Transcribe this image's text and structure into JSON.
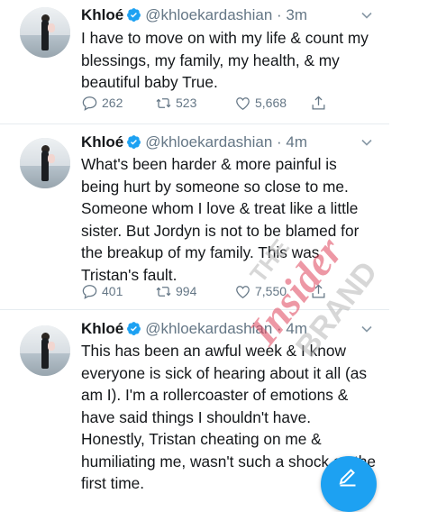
{
  "tweets": [
    {
      "display_name": "Khloé",
      "handle_time": "@khloekardashian · 3m",
      "text": "I have to move on with my life & count my blessings, my family, my health, & my beautiful baby True.",
      "replies": "262",
      "retweets": "523",
      "likes": "5,668"
    },
    {
      "display_name": "Khloé",
      "handle_time": "@khloekardashian · 4m",
      "text": "What's been harder & more painful is being hurt by someone so close to me. Someone whom I love & treat like a little sister. But Jordyn is not to be blamed for the breakup of my family. This was Tristan's fault.",
      "replies": "401",
      "retweets": "994",
      "likes": "7,550"
    },
    {
      "display_name": "Khloé",
      "handle_time": "@khloekardashian · 4m",
      "text": "This has been an awful week & I know everyone is sick of hearing about it all (as am I). I'm a rollercoaster of emotions & have said things I shouldn't have. Honestly, Tristan cheating on me & humiliating me, wasn't such a shock as the first time."
    }
  ],
  "watermark": {
    "line1": "THE",
    "line2": "Insider",
    "line3": "BRAND"
  },
  "colors": {
    "accent": "#1da1f2",
    "secondary_text": "#657786",
    "watermark_red": "#e0455c"
  },
  "icons": [
    "verified-badge-icon",
    "chevron-down-icon",
    "reply-icon",
    "retweet-icon",
    "like-icon",
    "share-icon",
    "compose-icon"
  ]
}
